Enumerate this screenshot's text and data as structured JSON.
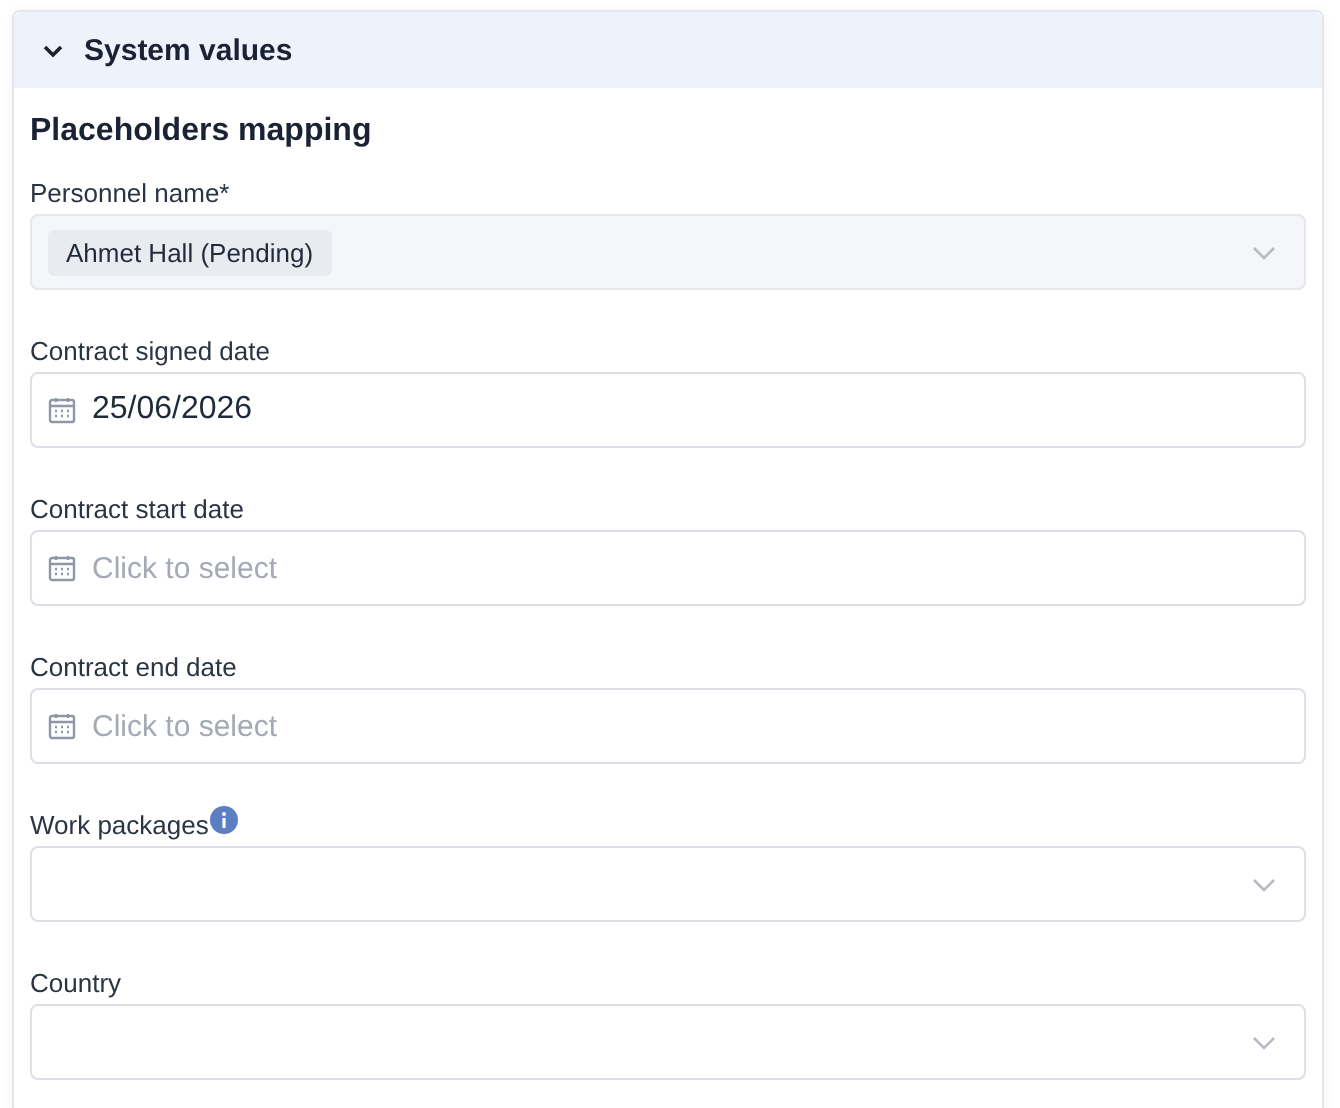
{
  "section": {
    "title": "System values",
    "expanded": true
  },
  "heading": "Placeholders mapping",
  "fields": [
    {
      "kind": "select",
      "label": "Personnel name*",
      "disabled": true,
      "chips": [
        "Ahmet Hall (Pending)"
      ]
    },
    {
      "kind": "date",
      "label": "Contract signed date",
      "value": "25/06/2026"
    },
    {
      "kind": "date",
      "label": "Contract start date",
      "placeholder": "Click to select"
    },
    {
      "kind": "date",
      "label": "Contract end date",
      "placeholder": "Click to select"
    },
    {
      "kind": "select",
      "label": "Work packages",
      "info": true,
      "disabled": false
    },
    {
      "kind": "select",
      "label": "Country",
      "disabled": false
    }
  ]
}
